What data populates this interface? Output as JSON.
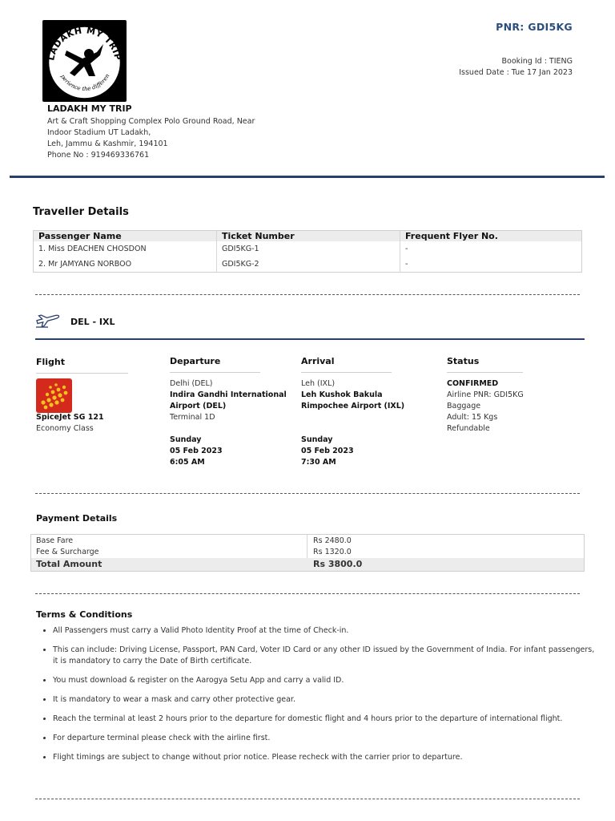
{
  "company": {
    "logo_text": "LADAKH MY TRIP",
    "logo_tagline": "Experience the difference",
    "name": "LADAKH MY TRIP",
    "address_line1": "Art & Craft Shopping Complex Polo Ground Road, Near",
    "address_line2": "Indoor Stadium UT Ladakh,",
    "address_line3": "Leh, Jammu & Kashmir, 194101",
    "phone": "Phone No : 919469336761"
  },
  "booking": {
    "pnr": "PNR: GDI5KG",
    "booking_id": "Booking Id : TIENG",
    "issued_date": "Issued Date : Tue 17 Jan 2023"
  },
  "traveller": {
    "title": "Traveller Details",
    "headers": [
      "Passenger Name",
      "Ticket Number",
      "Frequent Flyer No."
    ],
    "rows": [
      [
        "1. Miss DEACHEN CHOSDON",
        "GDI5KG-1",
        "-"
      ],
      [
        "2. Mr JAMYANG NORBOO",
        "GDI5KG-2",
        "-"
      ]
    ]
  },
  "route": {
    "label": "DEL - IXL",
    "icon": "airplane-icon"
  },
  "flight": {
    "header": "Flight",
    "airline_logo": "spicejet-logo",
    "name": "SpiceJet SG 121",
    "class": "Economy Class"
  },
  "departure": {
    "header": "Departure",
    "city": "Delhi (DEL)",
    "airport_line1": "Indira Gandhi International",
    "airport_line2": "Airport (DEL)",
    "terminal": "Terminal 1D",
    "day": "Sunday",
    "date": "05 Feb 2023",
    "time": "6:05 AM"
  },
  "arrival": {
    "header": "Arrival",
    "city": "Leh (IXL)",
    "airport_line1": "Leh Kushok Bakula",
    "airport_line2": "Rimpochee Airport (IXL)",
    "day": "Sunday",
    "date": "05 Feb 2023",
    "time": "7:30 AM"
  },
  "status": {
    "header": "Status",
    "value": "CONFIRMED",
    "airline_pnr": "Airline PNR: GDI5KG",
    "baggage_label": "Baggage",
    "baggage_value": "Adult: 15 Kgs",
    "refund": "Refundable"
  },
  "payment": {
    "title": "Payment Details",
    "base_fare_label": "Base Fare",
    "base_fare_value": "Rs 2480.0",
    "fee_label": "Fee & Surcharge",
    "fee_value": "Rs 1320.0",
    "total_label": "Total Amount",
    "total_value": "Rs 3800.0"
  },
  "terms": {
    "title": "Terms & Conditions",
    "items": [
      "All Passengers must carry a Valid Photo Identity Proof at the time of Check-in.",
      "This can include: Driving License, Passport, PAN Card, Voter ID Card or any other ID issued by the Government of India. For infant passengers, it is mandatory to carry the Date of Birth certificate.",
      "You must download & register on the Aarogya Setu App and carry a valid ID.",
      "It is mandatory to wear a mask and carry other protective gear.",
      "Reach the terminal at least 2 hours prior to the departure for domestic flight and 4 hours prior to the departure of international flight.",
      "For departure terminal please check with the airline first.",
      "Flight timings are subject to change without prior notice. Please recheck with the carrier prior to departure."
    ]
  },
  "colors": {
    "accent": "#2a3f6e",
    "pnr": "#2a4f7f",
    "spicejet_red": "#d42a1e",
    "spicejet_yellow": "#f6c21c"
  }
}
